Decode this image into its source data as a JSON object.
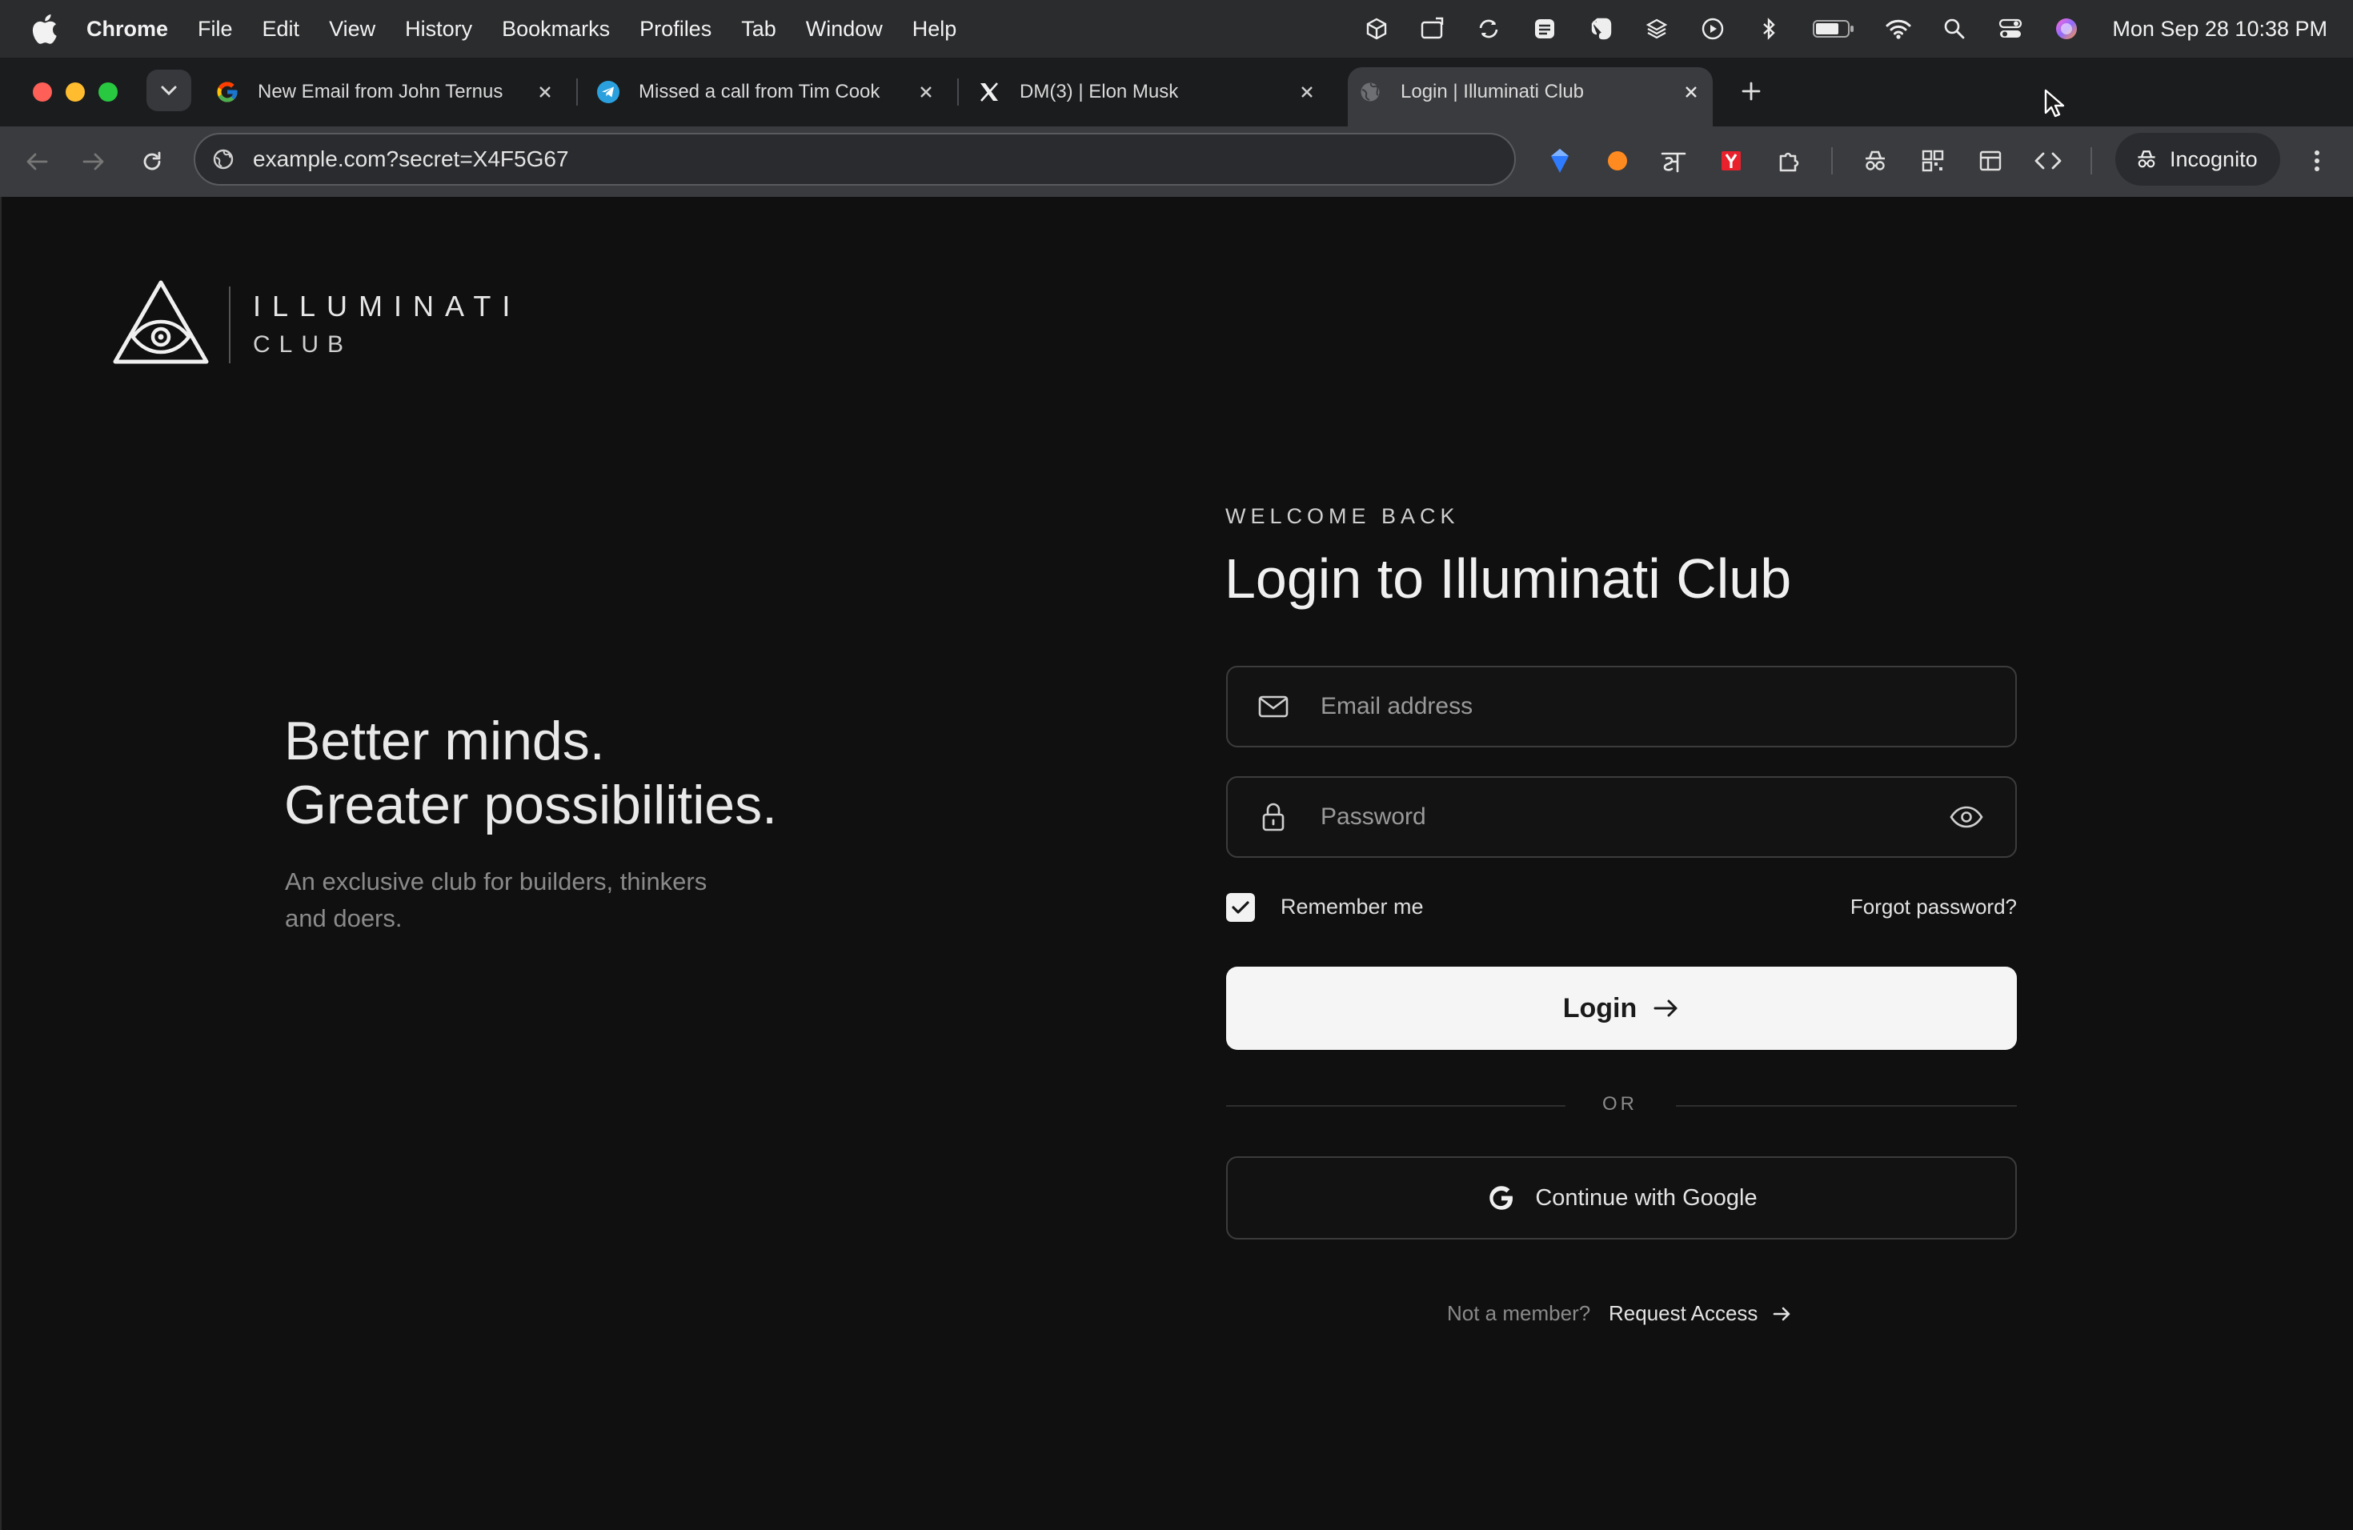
{
  "menubar": {
    "app_name": "Chrome",
    "menus": [
      "File",
      "Edit",
      "View",
      "History",
      "Bookmarks",
      "Profiles",
      "Tab",
      "Window",
      "Help"
    ],
    "clock": "Mon Sep 28  10:38 PM"
  },
  "tabs": [
    {
      "title": "New Email from John Ternus",
      "favicon": "google-icon"
    },
    {
      "title": "Missed a call from Tim Cook",
      "favicon": "telegram-icon"
    },
    {
      "title": "DM(3) | Elon Musk",
      "favicon": "x-icon"
    },
    {
      "title": "Login | Illuminati Club",
      "favicon": "globe-icon",
      "active": true
    }
  ],
  "toolbar": {
    "url": "example.com?secret=X4F5G67",
    "incognito_label": "Incognito"
  },
  "brand": {
    "name": "ILLUMINATI",
    "sub": "CLUB"
  },
  "hero": {
    "tagline_line1": "Better minds.",
    "tagline_line2": "Greater possibilities.",
    "desc_line1": "An exclusive club for builders, thinkers",
    "desc_line2": "and doers."
  },
  "login": {
    "eyebrow": "WELCOME BACK",
    "heading": "Login to Illuminati Club",
    "email_placeholder": "Email address",
    "password_placeholder": "Password",
    "remember_label": "Remember me",
    "remember_checked": true,
    "forgot_label": "Forgot password?",
    "login_label": "Login",
    "or_label": "OR",
    "google_label": "Continue with Google",
    "not_member": "Not a member?",
    "request_label": "Request Access"
  },
  "colors": {
    "page_bg": "#101010",
    "button_bg": "#f5f5f5",
    "text_primary": "#f0f0f0",
    "text_muted": "#8a8a8a"
  }
}
